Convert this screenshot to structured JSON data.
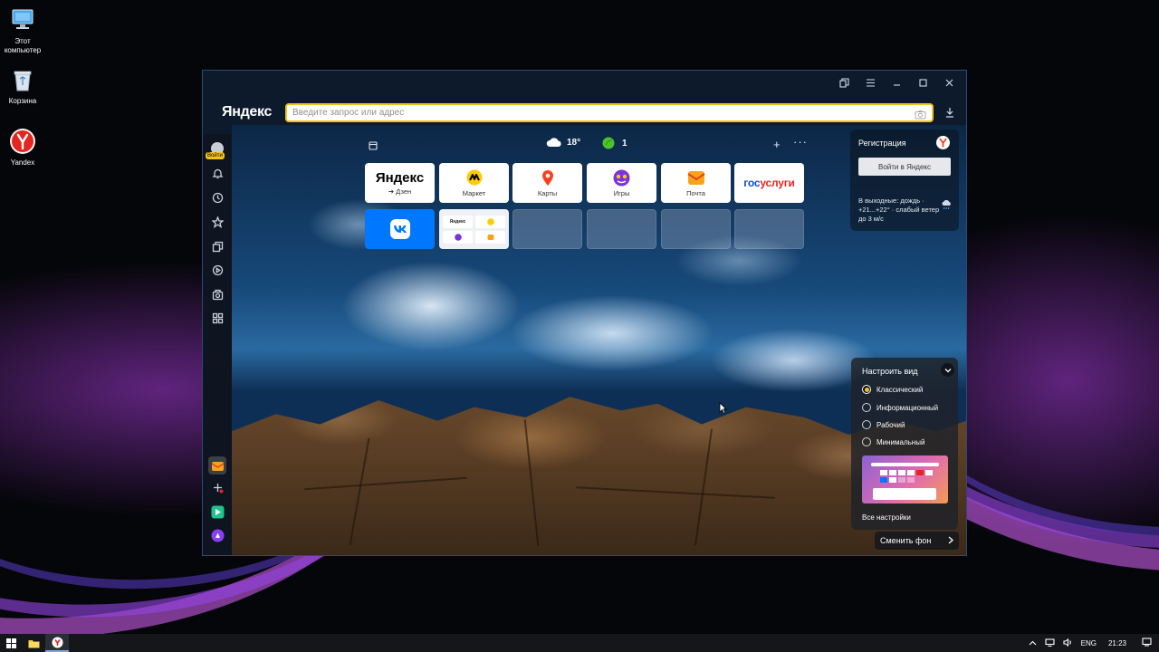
{
  "desktop": {
    "icons": [
      {
        "label_line1": "Этот",
        "label_line2": "компьютер",
        "icon": "computer-icon"
      },
      {
        "label_line1": "Корзина",
        "label_line2": "",
        "icon": "recycle-bin-icon"
      },
      {
        "label_line1": "Yandex",
        "label_line2": "",
        "icon": "yandex-browser-icon"
      }
    ]
  },
  "browser": {
    "logo": "Яндекс",
    "search": {
      "placeholder": "Введите запрос или адрес",
      "value": ""
    },
    "sidebar": {
      "login_badge": "Войти"
    },
    "widgets": {
      "weather_temp": "18°",
      "neuro_count": "1"
    },
    "tiles": [
      {
        "name": "Яндекс",
        "label": "➔ Дзен",
        "icon": "yandex-logo-icon"
      },
      {
        "name": "Маркет",
        "label": "Маркет",
        "icon": "market-icon"
      },
      {
        "name": "Карты",
        "label": "Карты",
        "icon": "maps-icon"
      },
      {
        "name": "Игры",
        "label": "Игры",
        "icon": "games-icon"
      },
      {
        "name": "Почта",
        "label": "Почта",
        "icon": "mail-icon"
      },
      {
        "name": "госуслуги",
        "label": "",
        "icon": "gosuslugi-logo"
      },
      {
        "name": "VK",
        "label": "",
        "icon": "vk-icon"
      },
      {
        "name": "folder",
        "label": "",
        "mini_label": "Яндекс",
        "icon": "folder-icon"
      }
    ],
    "account_panel": {
      "register": "Регистрация",
      "login_button": "Войти в Яндекс",
      "forecast": "В выходные: дождь · +21...+22° · слабый ветер до 3 м/с"
    },
    "customize": {
      "title": "Настроить вид",
      "options": [
        "Классический",
        "Информационный",
        "Рабочий",
        "Минимальный"
      ],
      "selected": "Классический",
      "all_settings": "Все настройки"
    },
    "change_background": "Сменить фон"
  },
  "taskbar": {
    "lang": "ENG",
    "time": "21:23"
  },
  "colors": {
    "accent_yellow": "#f3c317",
    "vk_blue": "#0077ff",
    "yandex_red": "#fc3f1d"
  }
}
